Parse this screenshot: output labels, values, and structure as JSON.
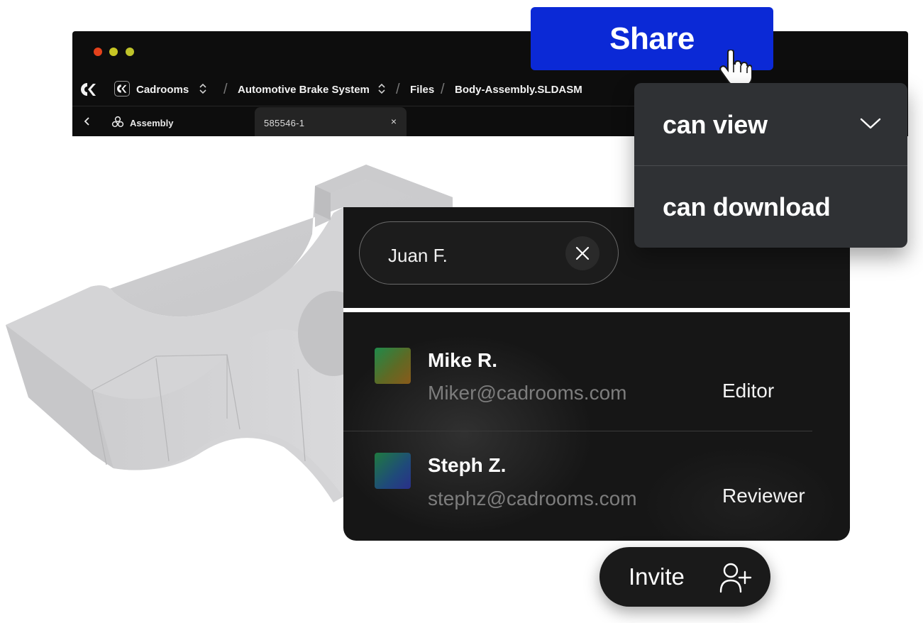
{
  "window": {
    "app_name": "Cadrooms"
  },
  "breadcrumb": {
    "workspace": "Cadrooms",
    "project": "Automotive Brake System",
    "section": "Files",
    "file": "Body-Assembly.SLDASM",
    "separator": "/"
  },
  "tabs": {
    "assembly_label": "Assembly",
    "open_tab": "585546-1",
    "close_glyph": "×"
  },
  "share": {
    "button_label": "Share"
  },
  "permissions": {
    "options": [
      "can view",
      "can download"
    ]
  },
  "invite_chip": {
    "name": "Juan F."
  },
  "users": [
    {
      "name": "Mike R.",
      "email": "Miker@cadrooms.com",
      "role": "Editor"
    },
    {
      "name": "Steph Z.",
      "email": "stephz@cadrooms.com",
      "role": "Reviewer"
    }
  ],
  "invite": {
    "label": "Invite"
  },
  "colors": {
    "share_blue": "#0b29d6",
    "panel_dark": "#161616",
    "dropdown_bg": "#2f3134",
    "email_gray": "#7d7d7d"
  },
  "icons": [
    "app-logo-icon",
    "workspace-logo-icon",
    "updown-icon",
    "chevron-left-icon",
    "assembly-icon",
    "close-icon",
    "hand-cursor-icon",
    "chevron-down-icon",
    "add-user-icon"
  ]
}
